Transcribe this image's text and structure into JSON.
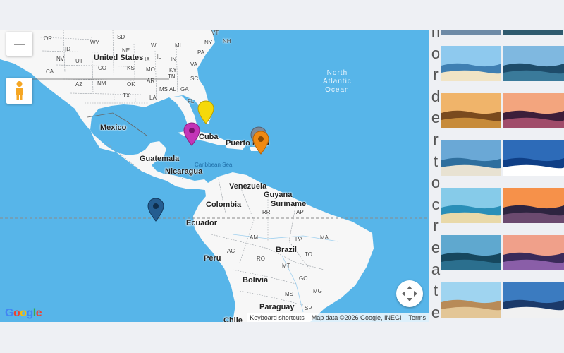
{
  "map": {
    "countries": [
      "United States",
      "Mexico",
      "Guatemala",
      "Nicaragua",
      "Cuba",
      "Puerto Rico",
      "Venezuela",
      "Guyana",
      "Suriname",
      "Colombia",
      "Ecuador",
      "Peru",
      "Brazil",
      "Bolivia",
      "Paraguay",
      "Chile"
    ],
    "states": [
      "OR",
      "ID",
      "WY",
      "SD",
      "NE",
      "NV",
      "UT",
      "CO",
      "KS",
      "IA",
      "CA",
      "AZ",
      "NM",
      "OK",
      "TX",
      "AR",
      "MS",
      "AL",
      "GA",
      "FL",
      "LA",
      "TN",
      "IN",
      "MI",
      "PA",
      "NY",
      "VT",
      "WI",
      "IL",
      "KY",
      "VA",
      "SC",
      "MO",
      "NH",
      "AM",
      "PA",
      "AP",
      "RR",
      "MA",
      "AC",
      "RO",
      "MT",
      "TO",
      "GO",
      "MS",
      "MG",
      "SP"
    ],
    "oceans": {
      "atlantic": [
        "North",
        "Atlantic",
        "Ocean"
      ],
      "caribbean": "Caribbean Sea"
    },
    "markers": [
      {
        "name": "yellow-marker",
        "color": "#f5d90a"
      },
      {
        "name": "purple-marker",
        "color": "#c435b8"
      },
      {
        "name": "orange-marker",
        "color": "#f08a13"
      },
      {
        "name": "gray-marker",
        "color": "#7d8a99"
      },
      {
        "name": "blue-marker",
        "color": "#245d91"
      }
    ],
    "logo": "Google",
    "footer": {
      "shortcuts": "Keyboard shortcuts",
      "attribution": "Map data ©2026 Google, INEGI",
      "terms": "Terms"
    },
    "colors": {
      "water": "#57b5e9",
      "land": "#f7f7f7"
    }
  },
  "vertical_text": [
    "n",
    "o",
    "r",
    "d",
    "e",
    "r",
    "t",
    "o",
    "c",
    "r",
    "e",
    "a",
    "t",
    "e"
  ],
  "thumbnails": [
    {
      "name": "harbor-town"
    },
    {
      "name": "overwater-bungalows"
    },
    {
      "name": "beach-visitors"
    },
    {
      "name": "sunset-temples"
    },
    {
      "name": "rocky-bay"
    },
    {
      "name": "blue-dome-church"
    },
    {
      "name": "tropical-beach"
    },
    {
      "name": "beach-umbrella-sunset"
    },
    {
      "name": "lagoon-resort"
    },
    {
      "name": "cliff-sunset"
    },
    {
      "name": "sandcastle-beach"
    },
    {
      "name": "windmills"
    }
  ]
}
